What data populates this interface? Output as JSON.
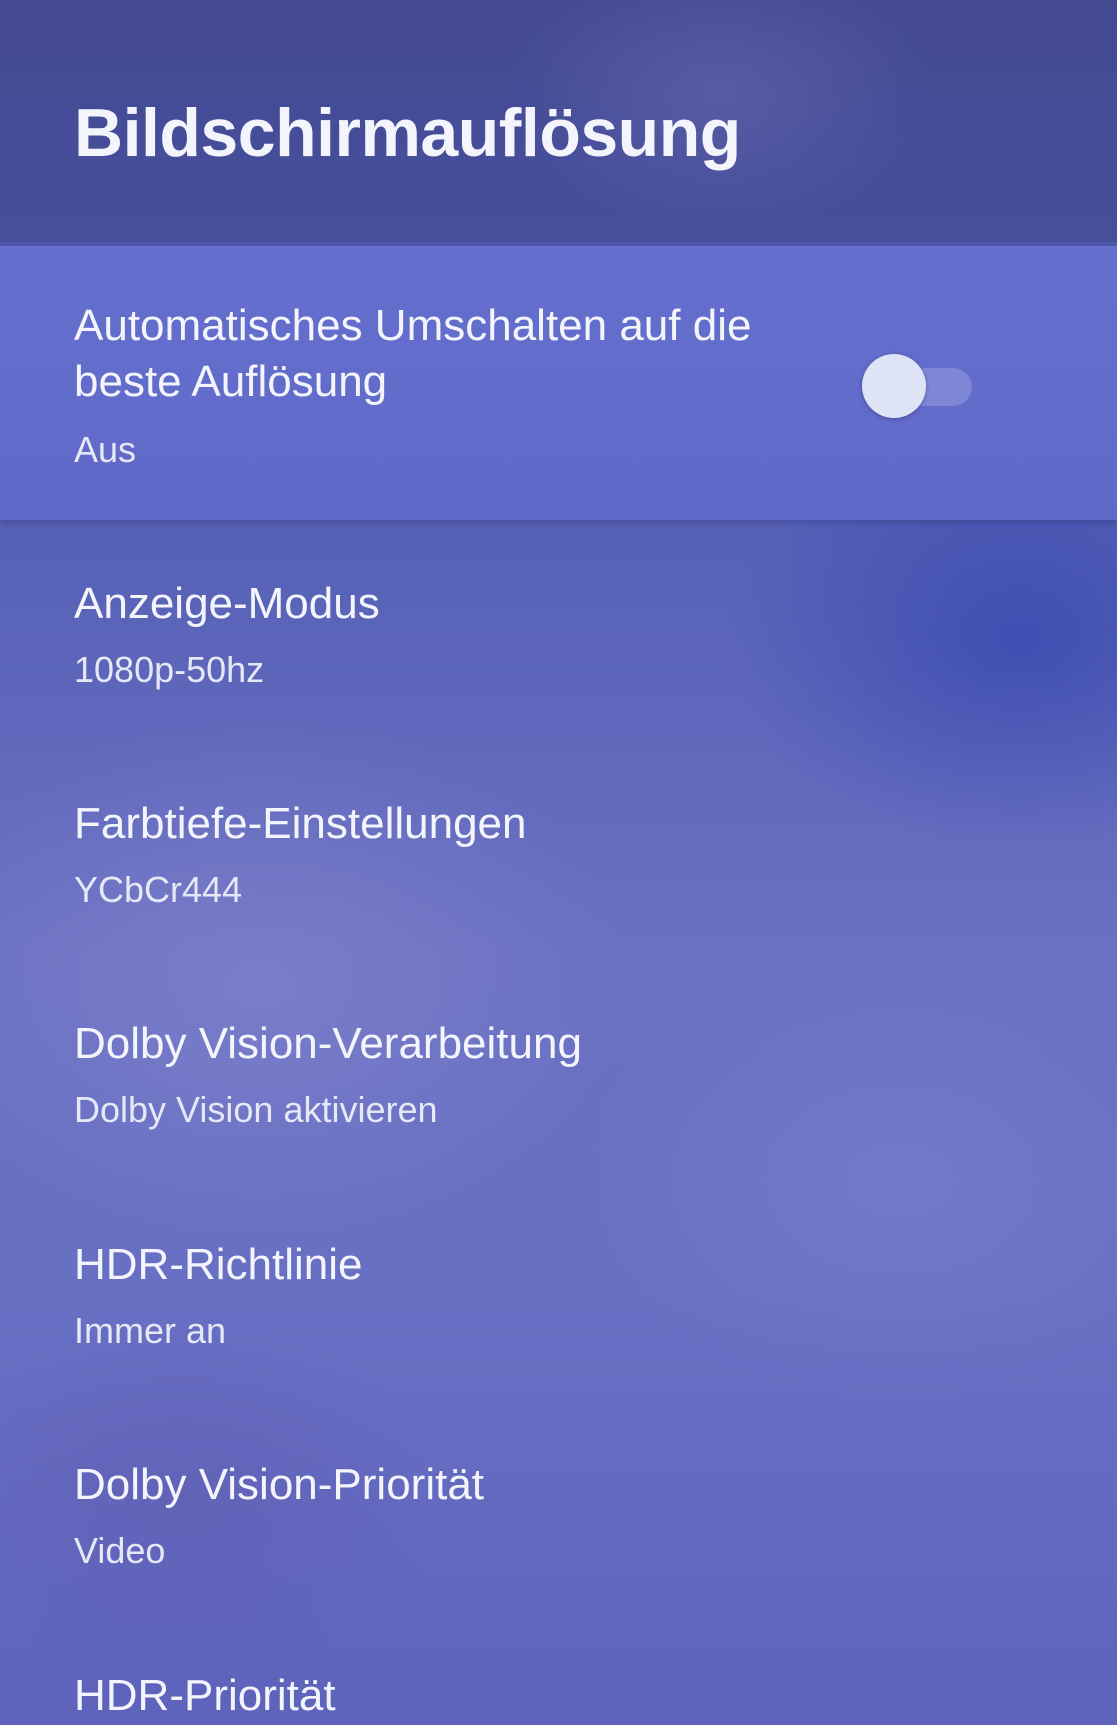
{
  "header": {
    "title": "Bildschirmauflösung"
  },
  "settings": {
    "auto_resolution": {
      "title": "Automatisches Umschalten auf die beste Auflösung",
      "value": "Aus",
      "enabled": false
    },
    "items": [
      {
        "title": "Anzeige-Modus",
        "value": "1080p-50hz"
      },
      {
        "title": "Farbtiefe-Einstellungen",
        "value": "YCbCr444"
      },
      {
        "title": "Dolby Vision-Verarbeitung",
        "value": "Dolby Vision aktivieren"
      },
      {
        "title": "HDR-Richtlinie",
        "value": "Immer an"
      },
      {
        "title": "Dolby Vision-Priorität",
        "value": "Video"
      },
      {
        "title": "HDR-Priorität"
      }
    ]
  }
}
